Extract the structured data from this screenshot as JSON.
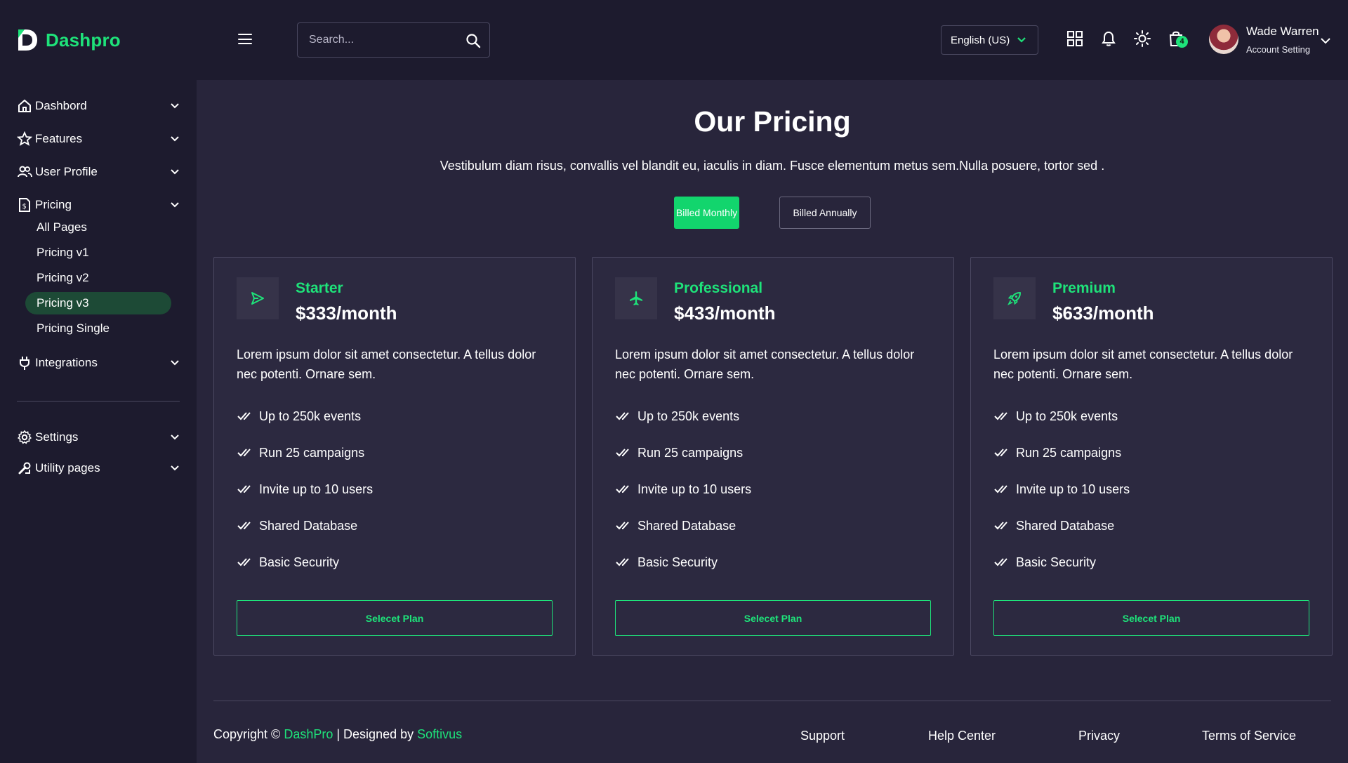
{
  "brand": {
    "name": "Dashpro",
    "accent": "#1ee37a"
  },
  "header": {
    "search_placeholder": "Search...",
    "language": "English (US)",
    "cart_count": "4",
    "user": {
      "name": "Wade Warren",
      "subtitle": "Account Setting"
    }
  },
  "sidebar": {
    "items": [
      {
        "label": "Dashbord",
        "icon": "home-icon"
      },
      {
        "label": "Features",
        "icon": "star-icon"
      },
      {
        "label": "User Profile",
        "icon": "users-icon"
      },
      {
        "label": "Pricing",
        "icon": "invoice-icon"
      },
      {
        "label": "Integrations",
        "icon": "plug-icon"
      },
      {
        "label": "Settings",
        "icon": "gear-icon"
      },
      {
        "label": "Utility pages",
        "icon": "tools-icon"
      }
    ],
    "pricing_sub": [
      "All Pages",
      "Pricing v1",
      "Pricing v2",
      "Pricing v3",
      "Pricing Single"
    ],
    "active_sub": "Pricing v3"
  },
  "main": {
    "title": "Our Pricing",
    "subtitle": "Vestibulum diam risus, convallis vel blandit eu, iaculis in diam. Fusce elementum metus sem.Nulla posuere, tortor sed .",
    "billing": {
      "monthly": "Billed Monthly",
      "annually": "Billed Annually",
      "selected": "monthly"
    },
    "plans": [
      {
        "name": "Starter",
        "price": "$333/month",
        "icon": "send-icon",
        "description": "Lorem ipsum dolor sit amet consectetur. A tellus dolor nec potenti. Ornare sem.",
        "features": [
          "Up to 250k events",
          "Run 25 campaigns",
          "Invite up to 10 users",
          "Shared Database",
          "Basic Security"
        ],
        "button": "Selecet Plan"
      },
      {
        "name": "Professional",
        "price": "$433/month",
        "icon": "airplane-icon",
        "description": "Lorem ipsum dolor sit amet consectetur. A tellus dolor nec potenti. Ornare sem.",
        "features": [
          "Up to 250k events",
          "Run 25 campaigns",
          "Invite up to 10 users",
          "Shared Database",
          "Basic Security"
        ],
        "button": "Selecet Plan"
      },
      {
        "name": "Premium",
        "price": "$633/month",
        "icon": "rocket-icon",
        "description": "Lorem ipsum dolor sit amet consectetur. A tellus dolor nec potenti. Ornare sem.",
        "features": [
          "Up to 250k events",
          "Run 25 campaigns",
          "Invite up to 10 users",
          "Shared Database",
          "Basic Security"
        ],
        "button": "Selecet Plan"
      }
    ]
  },
  "footer": {
    "copyright_prefix": "Copyright ©",
    "brand_link": "DashPro",
    "designed_by": "| Designed by",
    "designer_link": "Softivus",
    "links": [
      "Support",
      "Help Center",
      "Privacy",
      "Terms of Service"
    ]
  }
}
